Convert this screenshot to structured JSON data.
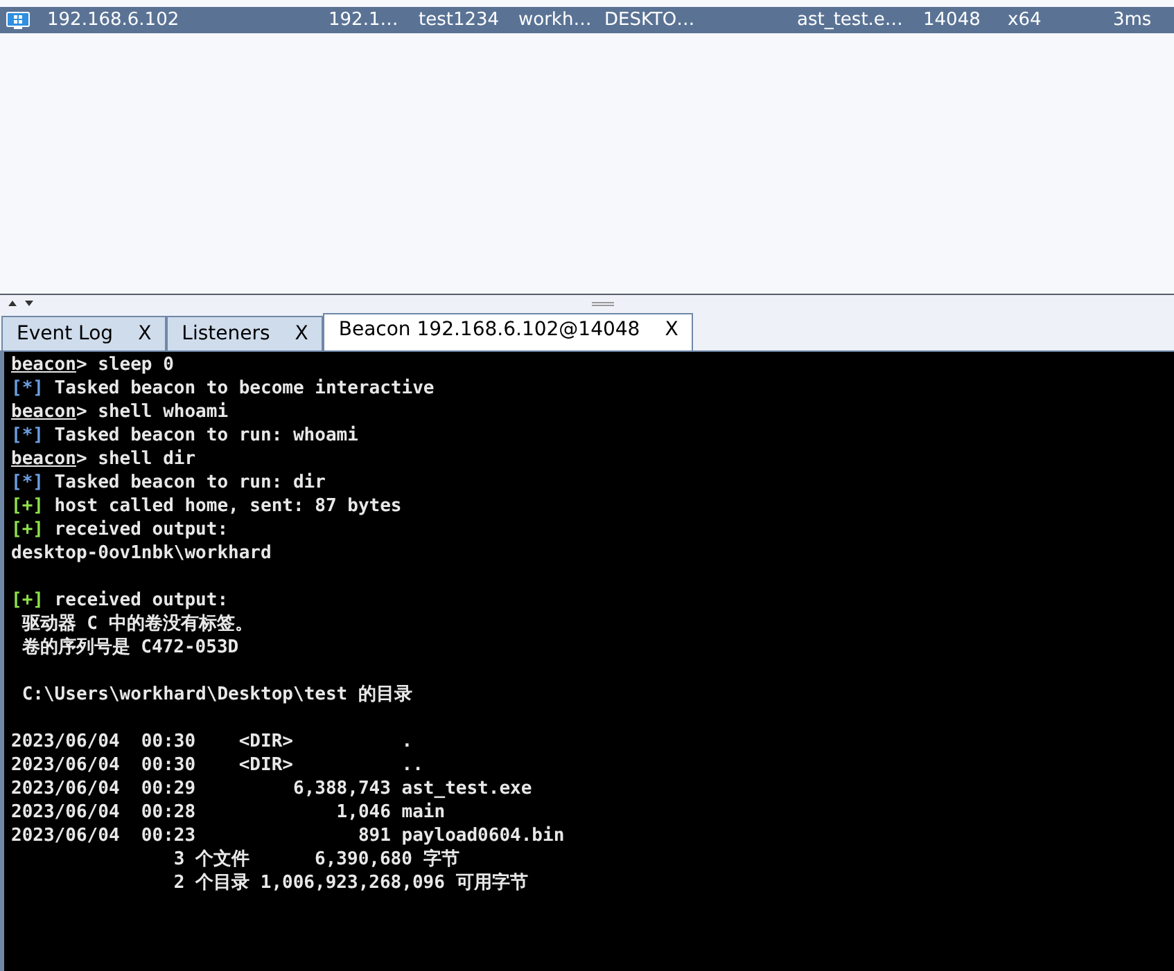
{
  "sessions": [
    {
      "selected": true,
      "cells": [
        "192.168.6.102",
        "192.1…",
        "test1234",
        "workh…",
        "DESKTO…",
        "ast_test.e…",
        "14048",
        "x64",
        "3ms"
      ]
    }
  ],
  "tabs": [
    {
      "label": "Event Log",
      "close": "X",
      "selected": false
    },
    {
      "label": "Listeners",
      "close": "X",
      "selected": false
    },
    {
      "label": "Beacon 192.168.6.102@14048",
      "close": "X",
      "selected": true
    }
  ],
  "console": {
    "lines": [
      {
        "kind": "prompt",
        "prompt": "beacon",
        "text": "> sleep 0"
      },
      {
        "kind": "task",
        "marker": "[*]",
        "text": "Tasked beacon to become interactive"
      },
      {
        "kind": "prompt",
        "prompt": "beacon",
        "text": "> shell whoami"
      },
      {
        "kind": "task",
        "marker": "[*]",
        "text": "Tasked beacon to run: whoami"
      },
      {
        "kind": "prompt",
        "prompt": "beacon",
        "text": "> shell dir"
      },
      {
        "kind": "task",
        "marker": "[*]",
        "text": "Tasked beacon to run: dir"
      },
      {
        "kind": "ok",
        "marker": "[+]",
        "text": "host called home, sent: 87 bytes"
      },
      {
        "kind": "ok",
        "marker": "[+]",
        "text": "received output:"
      },
      {
        "kind": "out",
        "text": "desktop-0ov1nbk\\workhard"
      },
      {
        "kind": "blank"
      },
      {
        "kind": "ok",
        "marker": "[+]",
        "text": "received output:"
      },
      {
        "kind": "out",
        "text": " 驱动器 C 中的卷没有标签。"
      },
      {
        "kind": "out",
        "text": " 卷的序列号是 C472-053D"
      },
      {
        "kind": "blank"
      },
      {
        "kind": "out",
        "text": " C:\\Users\\workhard\\Desktop\\test 的目录"
      },
      {
        "kind": "blank"
      },
      {
        "kind": "out",
        "text": "2023/06/04  00:30    <DIR>          ."
      },
      {
        "kind": "out",
        "text": "2023/06/04  00:30    <DIR>          .."
      },
      {
        "kind": "out",
        "text": "2023/06/04  00:29         6,388,743 ast_test.exe"
      },
      {
        "kind": "out",
        "text": "2023/06/04  00:28             1,046 main"
      },
      {
        "kind": "out",
        "text": "2023/06/04  00:23               891 payload0604.bin"
      },
      {
        "kind": "out",
        "text": "               3 个文件      6,390,680 字节"
      },
      {
        "kind": "out",
        "text": "               2 个目录 1,006,923,268,096 可用字节"
      }
    ]
  }
}
